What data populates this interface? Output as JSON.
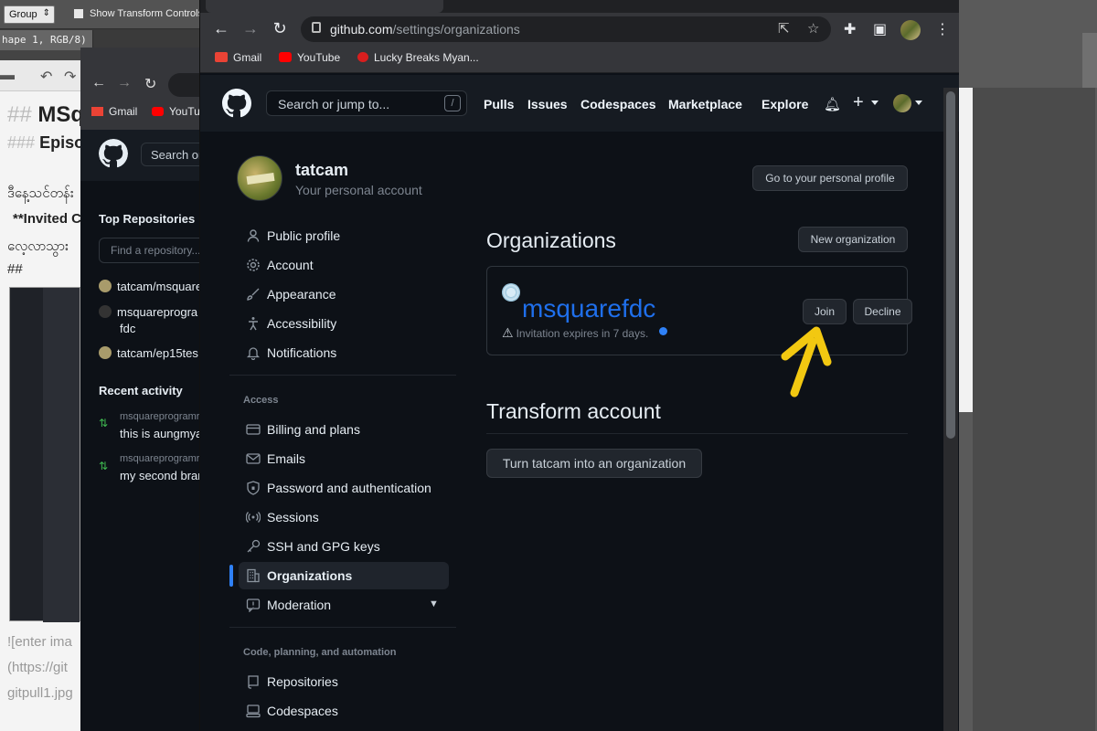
{
  "photoshop": {
    "group_select": "Group",
    "transform_label": "Show Transform Controls",
    "doc_tab": "hape 1, RGB/8)"
  },
  "md_editor": {
    "h2_hash": "##",
    "h2_text": "MSq",
    "h3_hash": "###",
    "h3_text": "Episo",
    "line1": "ဒီနေ့သင်တန်း",
    "invited": "**Invited C",
    "line3": "လေ့လာသွား",
    "hash_only": "##",
    "link1": "![enter ima",
    "link2": "(https://git",
    "link3": "gitpull1.jpg"
  },
  "behind_window": {
    "bookmarks": [
      "Gmail",
      "YouTu"
    ],
    "search": "Search or",
    "top_repos": "Top Repositories",
    "find_repo": "Find a repository...",
    "repos": [
      "tatcam/msquare",
      "msquareprogra",
      "fdc",
      "tatcam/ep15tes"
    ],
    "recent": "Recent activity",
    "activity": [
      {
        "meta": "msquareprogramr",
        "title": "this is aungmya"
      },
      {
        "meta": "msquareprogramr",
        "title": "my second bran"
      }
    ]
  },
  "browser": {
    "url_host": "github.com",
    "url_path": "/settings/organizations",
    "bookmarks": [
      "Gmail",
      "YouTube",
      "Lucky Breaks Myan..."
    ]
  },
  "gh_header": {
    "search_placeholder": "Search or jump to...",
    "slash": "/",
    "nav": [
      "Pulls",
      "Issues",
      "Codespaces",
      "Marketplace",
      "Explore"
    ]
  },
  "user": {
    "name": "tatcam",
    "subtitle": "Your personal account",
    "profile_button": "Go to your personal profile"
  },
  "sidebar": {
    "items": [
      {
        "label": "Public profile",
        "icon": "person-icon"
      },
      {
        "label": "Account",
        "icon": "gear-icon"
      },
      {
        "label": "Appearance",
        "icon": "paintbrush-icon"
      },
      {
        "label": "Accessibility",
        "icon": "accessibility-icon"
      },
      {
        "label": "Notifications",
        "icon": "bell-icon"
      }
    ],
    "access_heading": "Access",
    "access_items": [
      {
        "label": "Billing and plans",
        "icon": "credit-card-icon"
      },
      {
        "label": "Emails",
        "icon": "mail-icon"
      },
      {
        "label": "Password and authentication",
        "icon": "shield-lock-icon"
      },
      {
        "label": "Sessions",
        "icon": "broadcast-icon"
      },
      {
        "label": "SSH and GPG keys",
        "icon": "key-icon"
      },
      {
        "label": "Organizations",
        "icon": "organization-icon"
      },
      {
        "label": "Moderation",
        "icon": "report-icon"
      }
    ],
    "code_heading": "Code, planning, and automation",
    "code_items": [
      {
        "label": "Repositories",
        "icon": "repo-icon"
      },
      {
        "label": "Codespaces",
        "icon": "codespaces-icon"
      }
    ]
  },
  "organizations": {
    "heading": "Organizations",
    "new_button": "New organization",
    "org_name": "msquarefdc",
    "expires": "Invitation expires in 7 days.",
    "join": "Join",
    "decline": "Decline"
  },
  "transform": {
    "heading": "Transform account",
    "button": "Turn tatcam into an organization"
  },
  "colors": {
    "accent": "#2f81f7",
    "org_link": "#1f6feb",
    "annotation_arrow": "#f2c811"
  }
}
